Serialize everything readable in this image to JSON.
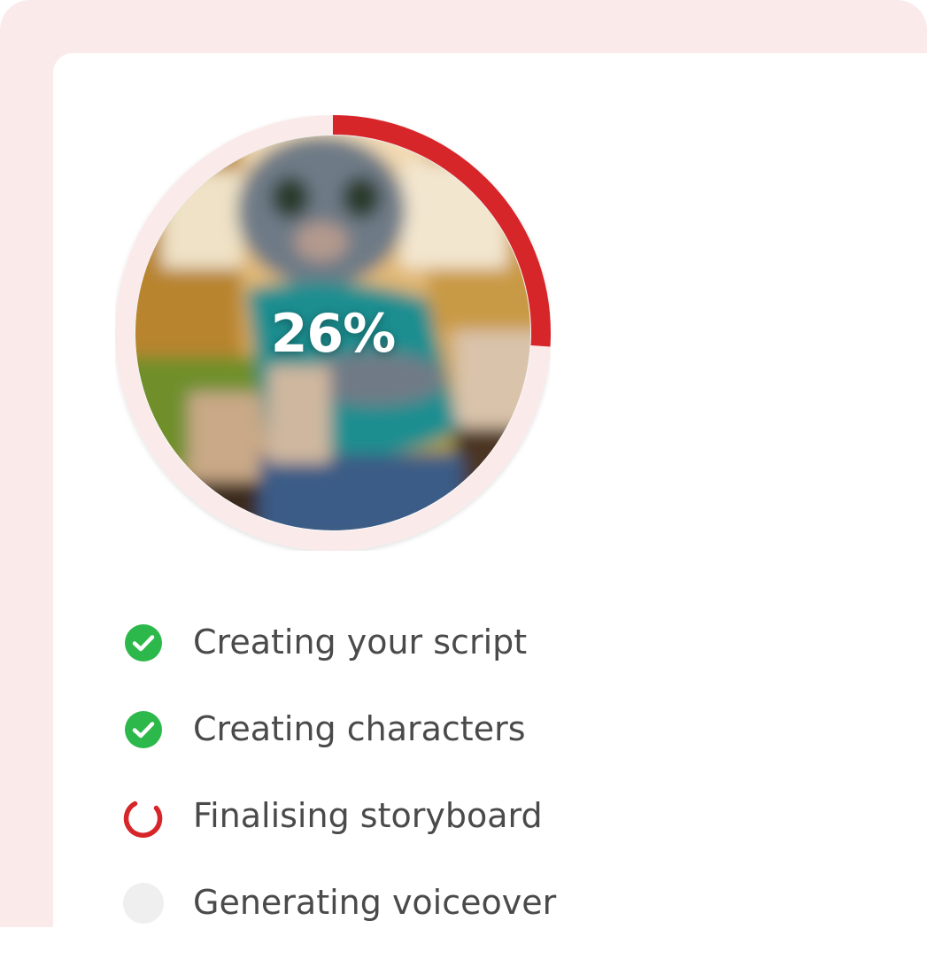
{
  "progress": {
    "percent_label": "26%",
    "fraction": 0.26,
    "track_color": "#fbeaea",
    "fill_color": "#d7262a",
    "image": "blurred-cat-in-hoodie-photo"
  },
  "steps": [
    {
      "label": "Creating your script",
      "status": "done",
      "icon": "check-circle-icon"
    },
    {
      "label": "Creating characters",
      "status": "done",
      "icon": "check-circle-icon"
    },
    {
      "label": "Finalising storyboard",
      "status": "in-progress",
      "icon": "spinner-icon"
    },
    {
      "label": "Generating voiceover",
      "status": "pending",
      "icon": "pending-circle-icon"
    }
  ],
  "colors": {
    "background": "#fbeaea",
    "card": "#ffffff",
    "done": "#2db84b",
    "in_progress": "#d7262a",
    "pending": "#efefef",
    "text": "#4a4a4a"
  }
}
